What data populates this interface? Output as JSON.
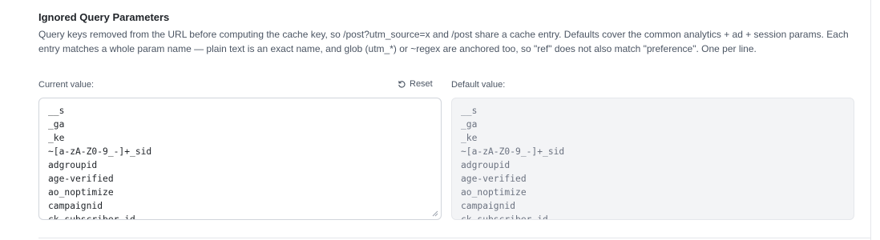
{
  "setting": {
    "title": "Ignored Query Parameters",
    "description": "Query keys removed from the URL before computing the cache key, so /post?utm_source=x and /post share a cache entry. Defaults cover the common analytics + ad + session params. Each entry matches a whole param name — plain text is an exact name, and glob (utm_*) or ~regex are anchored too, so \"ref\" does not also match \"preference\". One per line.",
    "current_label": "Current value:",
    "reset_label": "Reset",
    "default_label": "Default value:",
    "current_lines": [
      "__s",
      "_ga",
      "_ke",
      "~[a-zA-Z0-9_-]+_sid",
      "adgroupid",
      "age-verified",
      "ao_noptimize",
      "campaignid",
      "ck_subscriber_id"
    ],
    "default_lines": [
      "__s",
      "_ga",
      "_ke",
      "~[a-zA-Z0-9_-]+_sid",
      "adgroupid",
      "age-verified",
      "ao_noptimize",
      "campaignid",
      "ck_subscriber_id"
    ]
  },
  "icons": {
    "reset": "reset-icon",
    "resize": "resize-handle-icon"
  }
}
